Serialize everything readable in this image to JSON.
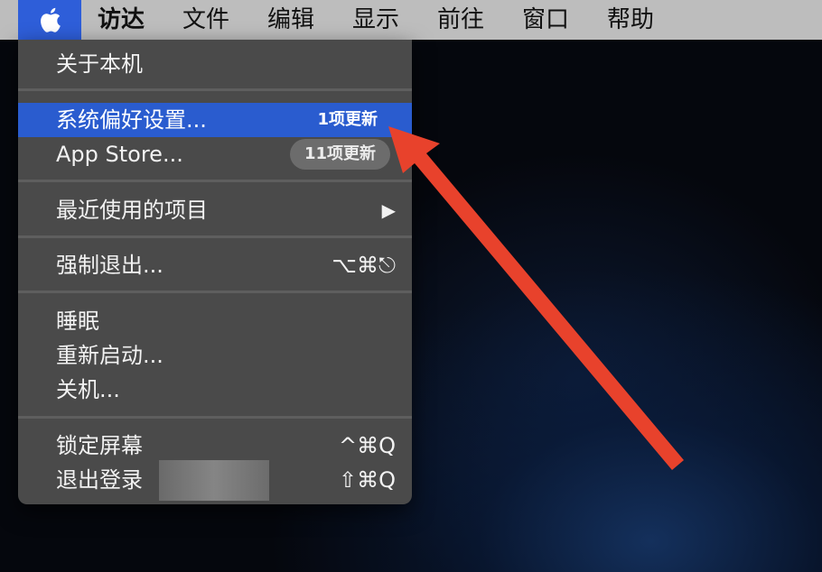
{
  "menubar": {
    "apple_icon": "apple-logo-icon",
    "items": [
      "访达",
      "文件",
      "编辑",
      "显示",
      "前往",
      "窗口",
      "帮助"
    ]
  },
  "menu": {
    "about": "关于本机",
    "system_prefs": {
      "label": "系统偏好设置...",
      "badge": "1项更新"
    },
    "app_store": {
      "label": "App Store...",
      "badge": "11项更新"
    },
    "recent_items": {
      "label": "最近使用的项目",
      "submenu_icon": "submenu-arrow-icon",
      "submenu_glyph": "▶"
    },
    "force_quit": {
      "label": "强制退出...",
      "shortcut": "⌥⌘⎋"
    },
    "sleep": "睡眠",
    "restart": "重新启动...",
    "shutdown": "关机...",
    "lock_screen": {
      "label": "锁定屏幕",
      "shortcut": "^⌘Q"
    },
    "logout": {
      "label": "退出登录",
      "shortcut": "⇧⌘Q"
    }
  },
  "colors": {
    "menubar_bg": "#bdbdbd",
    "apple_highlight": "#2e5ed9",
    "menu_bg": "#4a4a4a",
    "menu_highlight": "#2a5ccf",
    "annotation_arrow": "#e8422c"
  }
}
